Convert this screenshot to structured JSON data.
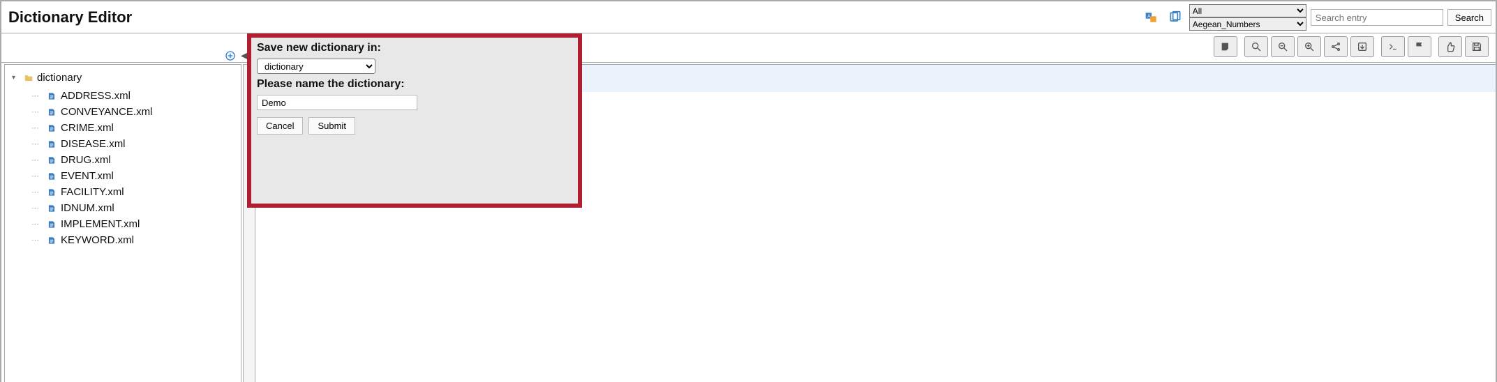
{
  "title": "Dictionary Editor",
  "top": {
    "select1": "All",
    "select2": "Aegean_Numbers",
    "search_placeholder": "Search entry",
    "search_button": "Search"
  },
  "tree": {
    "root": "dictionary",
    "items": [
      "ADDRESS.xml",
      "CONVEYANCE.xml",
      "CRIME.xml",
      "DISEASE.xml",
      "DRUG.xml",
      "EVENT.xml",
      "FACILITY.xml",
      "IDNUM.xml",
      "IMPLEMENT.xml",
      "KEYWORD.xml"
    ]
  },
  "modal": {
    "heading1": "Save new dictionary in:",
    "select_value": "dictionary",
    "heading2": "Please name the dictionary:",
    "name_value": "Demo",
    "cancel": "Cancel",
    "submit": "Submit"
  }
}
